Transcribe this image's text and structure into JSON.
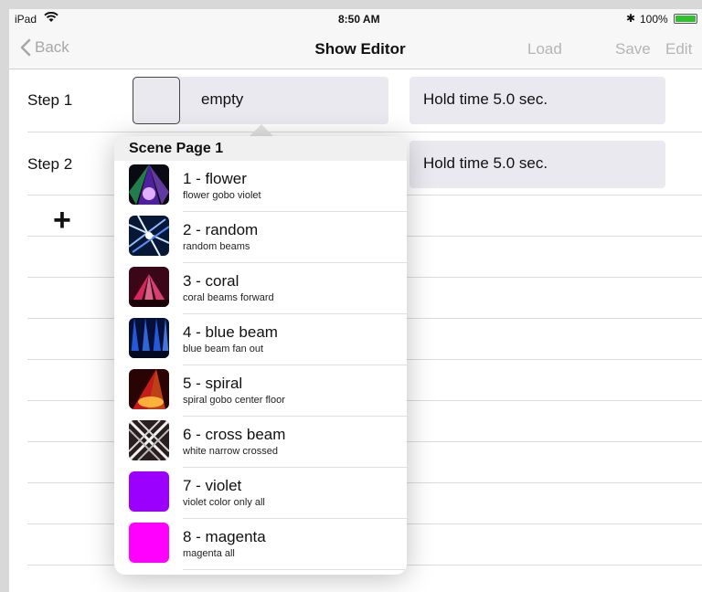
{
  "status_bar": {
    "carrier": "iPad",
    "time": "8:50 AM",
    "battery": "100%"
  },
  "nav": {
    "back_label": "Back",
    "title": "Show Editor",
    "load_label": "Load",
    "save_label": "Save",
    "edit_label": "Edit"
  },
  "steps": [
    {
      "label": "Step 1",
      "scene": "empty",
      "hold": "Hold time 5.0 sec."
    },
    {
      "label": "Step 2",
      "scene": "",
      "hold": "Hold time 5.0 sec."
    }
  ],
  "add_button": "+",
  "popover": {
    "title": "Scene Page 1",
    "scenes": [
      {
        "name": "1 - flower",
        "desc": "flower gobo violet",
        "icon": "flower-icon",
        "color": "#8a2be2"
      },
      {
        "name": "2 - random",
        "desc": "random beams",
        "icon": "random-beams-icon",
        "color": "#2a5bd7"
      },
      {
        "name": "3 - coral",
        "desc": "coral beams forward",
        "icon": "coral-beams-icon",
        "color": "#e0245e"
      },
      {
        "name": "4 - blue beam",
        "desc": "blue beam fan out",
        "icon": "blue-beam-icon",
        "color": "#1e4fd8"
      },
      {
        "name": "5 - spiral",
        "desc": "spiral gobo center floor",
        "icon": "spiral-icon",
        "color": "#d62828"
      },
      {
        "name": "6 - cross beam",
        "desc": "white narrow crossed",
        "icon": "cross-beam-icon",
        "color": "#5a4a4a"
      },
      {
        "name": "7 - violet",
        "desc": "violet color only all",
        "icon": "violet-swatch-icon",
        "color": "#9b00ff"
      },
      {
        "name": "8 - magenta",
        "desc": "magenta all",
        "icon": "magenta-swatch-icon",
        "color": "#ff00ff"
      }
    ]
  }
}
